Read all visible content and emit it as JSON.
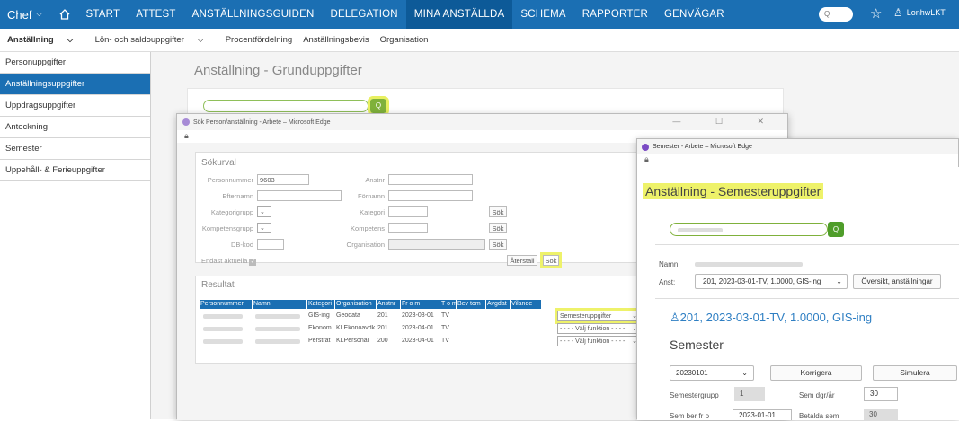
{
  "topnav": {
    "brand": "Chef",
    "items": [
      "START",
      "ATTEST",
      "ANSTÄLLNINGSGUIDEN",
      "DELEGATION",
      "MINA ANSTÄLLDA",
      "SCHEMA",
      "RAPPORTER",
      "GENVÄGAR"
    ],
    "search_placeholder": "Q",
    "username": "LonhwLKT"
  },
  "subnav": {
    "items": [
      "Anställning",
      "Lön- och saldouppgifter",
      "Procentfördelning",
      "Anställningsbevis",
      "Organisation"
    ]
  },
  "sidebar": {
    "items": [
      "Personuppgifter",
      "Anställningsuppgifter",
      "Uppdragsuppgifter",
      "Anteckning",
      "Semester",
      "Uppehåll- & Ferieuppgifter"
    ]
  },
  "main": {
    "title": "Anställning - Grunduppgifter",
    "search_icon": "Q"
  },
  "win1": {
    "title": "Sök Person/anställning - Arbete – Microsoft Edge",
    "controls": "— ☐ ✕",
    "section_title": "Sökurval",
    "labels": {
      "personnummer": "Personnummer",
      "efternamn": "Efternamn",
      "kategorigrupp": "Kategorigrupp",
      "kompetensgrupp": "Kompetensgrupp",
      "dbkod": "DB-kod",
      "endast": "Endast aktuella",
      "anstnr": "Anstnr",
      "fornamn": "Förnamn",
      "kategori": "Kategori",
      "kompetens": "Kompetens",
      "organisation": "Organisation"
    },
    "personnummer_value": "9603",
    "sok": "Sök",
    "aterstall": "Återställ",
    "results_title": "Resultat",
    "columns": [
      "Personnummer",
      "Namn",
      "Kategori",
      "Organisation",
      "Anstnr",
      "Fr o m",
      "T o m",
      "Bev tom",
      "Avgdat",
      "Vilande"
    ],
    "rows": [
      {
        "kategori": "GIS-ing",
        "org": "Geodata",
        "anstnr": "201",
        "from": "2023-03-01",
        "tom": "TV",
        "action": "Semesteruppgifter"
      },
      {
        "kategori": "Ekonom",
        "org": "KLEkonoavdk",
        "anstnr": "201",
        "from": "2023-04-01",
        "tom": "TV",
        "action": "- - - - Välj funktion - - - -"
      },
      {
        "kategori": "Perstrat",
        "org": "KLPersonal",
        "anstnr": "200",
        "from": "2023-04-01",
        "tom": "TV",
        "action": "- - - - Välj funktion - - - -"
      }
    ]
  },
  "win2": {
    "title": "Semester - Arbete – Microsoft Edge",
    "page_title": "Anställning - Semesteruppgifter",
    "search_icon": "Q",
    "namn_label": "Namn",
    "anst_label": "Anst:",
    "anst_value": "201, 2023-03-01-TV, 1.0000, GIS-ing",
    "oversikt": "Översikt, anställningar",
    "employee_heading": "201, 2023-03-01-TV, 1.0000, GIS-ing",
    "section": "Semester",
    "period": "20230101",
    "korrigera": "Korrigera",
    "simulera": "Simulera",
    "semestergrupp_label": "Semestergrupp",
    "semestergrupp_value": "1",
    "semdgr_label": "Sem dgr/år",
    "semdgr_value": "30",
    "semberfrom_label": "Sem ber fr o",
    "semberfrom_value": "2023-01-01",
    "betalda_label": "Betalda sem",
    "betalda_value": "30"
  }
}
